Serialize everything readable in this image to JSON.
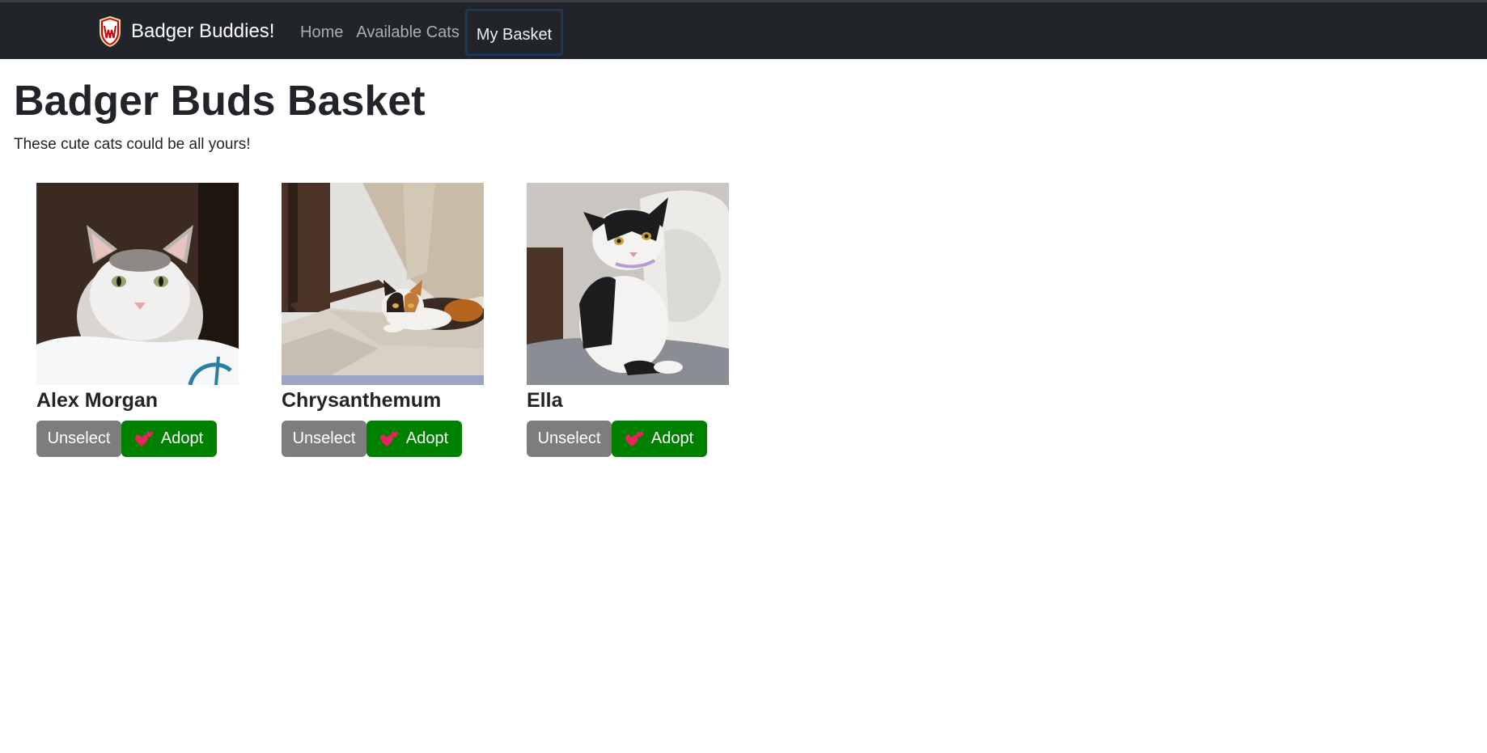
{
  "navbar": {
    "brand_text": "Badger Buddies!",
    "links": [
      {
        "label": "Home"
      },
      {
        "label": "Available Cats"
      },
      {
        "label": "My Basket"
      }
    ],
    "active_link": "My Basket"
  },
  "page": {
    "title": "Badger Buds Basket",
    "subtitle": "These cute cats could be all yours!"
  },
  "cats": [
    {
      "name": "Alex Morgan",
      "unselect_label": "Unselect",
      "adopt_label": "Adopt"
    },
    {
      "name": "Chrysanthemum",
      "unselect_label": "Unselect",
      "adopt_label": "Adopt"
    },
    {
      "name": "Ella",
      "unselect_label": "Unselect",
      "adopt_label": "Adopt"
    }
  ],
  "icons": {
    "brand": "uw-crest-icon",
    "adopt": "two-hearts-icon"
  },
  "colors": {
    "navbar_bg": "#212529",
    "adopt_button": "#008000",
    "unselect_button": "#7d7d7d",
    "heart": "#e8245a"
  }
}
